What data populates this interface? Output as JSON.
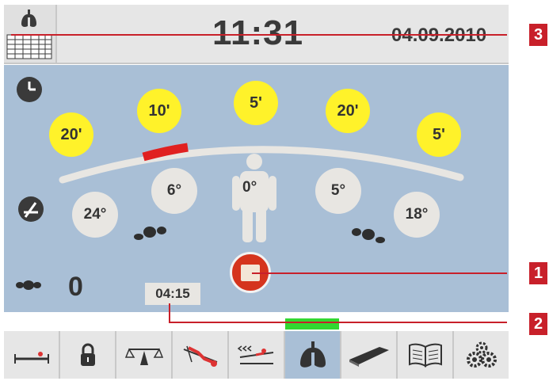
{
  "header": {
    "time": "11:31",
    "date": "04.09.2010"
  },
  "timing": {
    "durations": [
      "20'",
      "10'",
      "5'",
      "20'",
      "5'"
    ]
  },
  "angles": {
    "values": [
      "24°",
      "6°",
      "0°",
      "5°",
      "18°"
    ]
  },
  "position_indicator_progress": 0.2,
  "counter": "0",
  "elapsed_time": "04:15",
  "callouts": [
    "1",
    "2",
    "3"
  ],
  "toolbar": {
    "items": [
      "bed-flat-icon",
      "lock-icon",
      "scale-icon",
      "trendelenburg-icon",
      "bed-tilt-icon",
      "lungs-icon",
      "mattress-icon",
      "manual-book-icon",
      "settings-gears-icon"
    ],
    "active_index": 5
  },
  "colors": {
    "panel_blue": "#a9bfd6",
    "yellow": "#fff22a",
    "stop_red": "#d5341d",
    "active_green": "#31d831",
    "callout_red": "#c8202a"
  }
}
